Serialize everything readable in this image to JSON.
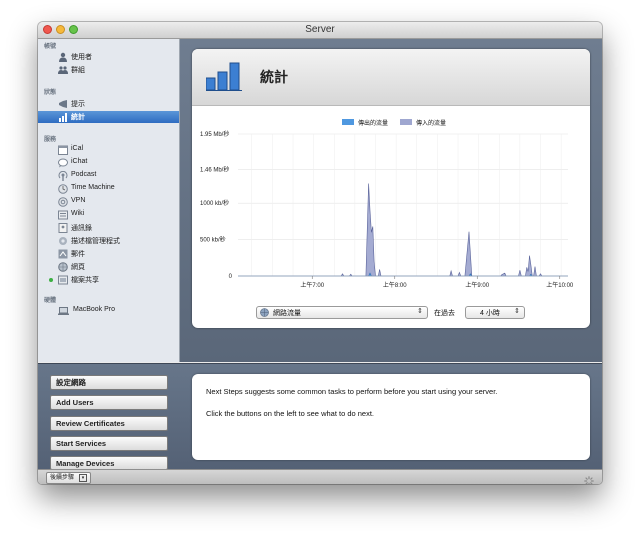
{
  "window": {
    "title": "Server"
  },
  "sidebar": {
    "sections": [
      {
        "header": "帳號",
        "items": [
          {
            "label": "使用者",
            "icon": "user-icon"
          },
          {
            "label": "群組",
            "icon": "group-icon"
          }
        ]
      },
      {
        "header": "狀態",
        "items": [
          {
            "label": "提示",
            "icon": "alert-icon"
          },
          {
            "label": "統計",
            "icon": "stats-icon",
            "selected": true
          }
        ]
      },
      {
        "header": "服務",
        "items": [
          {
            "label": "iCal",
            "icon": "calendar-icon"
          },
          {
            "label": "iChat",
            "icon": "chat-icon"
          },
          {
            "label": "Podcast",
            "icon": "podcast-icon"
          },
          {
            "label": "Time Machine",
            "icon": "time-machine-icon"
          },
          {
            "label": "VPN",
            "icon": "vpn-icon"
          },
          {
            "label": "Wiki",
            "icon": "wiki-icon"
          },
          {
            "label": "通訊錄",
            "icon": "contacts-icon"
          },
          {
            "label": "描述檔管理程式",
            "icon": "profile-manager-icon"
          },
          {
            "label": "郵件",
            "icon": "mail-icon"
          },
          {
            "label": "網頁",
            "icon": "web-icon"
          },
          {
            "label": "檔案共享",
            "icon": "file-sharing-icon",
            "status": "on"
          }
        ]
      },
      {
        "header": "硬體",
        "items": [
          {
            "label": "MacBook Pro",
            "icon": "laptop-icon"
          }
        ]
      }
    ]
  },
  "stats_panel": {
    "title": "統計",
    "icon": "bar-chart-icon",
    "metric_select": "網路流量",
    "range_label": "在過去",
    "range_select": "4 小時"
  },
  "chart_data": {
    "type": "area",
    "legend": [
      "傳出的流量",
      "傳入的流量"
    ],
    "legend_position": "top-center",
    "y_tick_labels": [
      "1.95 Mb/秒",
      "1.46 Mb/秒",
      "1000 kb/秒",
      "500 kb/秒",
      "0"
    ],
    "y_ticks_kbps": [
      1950,
      1460,
      1000,
      500,
      0
    ],
    "ylim": [
      0,
      1950
    ],
    "x_tick_labels": [
      "上午7:00",
      "上午8:00",
      "上午9:00",
      "上午10:00"
    ],
    "x_ticks": [
      "06:59",
      "07:59",
      "08:59",
      "09:59"
    ],
    "xlim": [
      "06:05",
      "10:05"
    ],
    "grid": true,
    "series": [
      {
        "name": "傳入的流量",
        "color": "#9fa7d0",
        "points": [
          [
            "06:05",
            0
          ],
          [
            "07:20",
            0
          ],
          [
            "07:21",
            30
          ],
          [
            "07:22",
            0
          ],
          [
            "07:26",
            0
          ],
          [
            "07:27",
            25
          ],
          [
            "07:28",
            0
          ],
          [
            "07:38",
            0
          ],
          [
            "07:40",
            1270
          ],
          [
            "07:41",
            900
          ],
          [
            "07:42",
            600
          ],
          [
            "07:43",
            680
          ],
          [
            "07:44",
            200
          ],
          [
            "07:45",
            0
          ],
          [
            "07:47",
            0
          ],
          [
            "07:48",
            90
          ],
          [
            "07:49",
            0
          ],
          [
            "08:39",
            0
          ],
          [
            "08:40",
            70
          ],
          [
            "08:41",
            0
          ],
          [
            "08:45",
            0
          ],
          [
            "08:46",
            50
          ],
          [
            "08:47",
            0
          ],
          [
            "08:50",
            0
          ],
          [
            "08:53",
            610
          ],
          [
            "08:55",
            0
          ],
          [
            "09:16",
            0
          ],
          [
            "09:17",
            20
          ],
          [
            "09:19",
            40
          ],
          [
            "09:20",
            0
          ],
          [
            "09:29",
            0
          ],
          [
            "09:30",
            80
          ],
          [
            "09:31",
            0
          ],
          [
            "09:34",
            0
          ],
          [
            "09:35",
            120
          ],
          [
            "09:36",
            60
          ],
          [
            "09:37",
            280
          ],
          [
            "09:38",
            150
          ],
          [
            "09:39",
            0
          ],
          [
            "09:40",
            0
          ],
          [
            "09:41",
            130
          ],
          [
            "09:42",
            0
          ],
          [
            "09:44",
            0
          ],
          [
            "09:45",
            30
          ],
          [
            "09:46",
            0
          ],
          [
            "10:05",
            0
          ]
        ]
      },
      {
        "name": "傳出的流量",
        "color": "#4f98e0",
        "points": [
          [
            "06:05",
            0
          ],
          [
            "07:40",
            0
          ],
          [
            "07:41",
            40
          ],
          [
            "07:42",
            0
          ],
          [
            "08:53",
            0
          ],
          [
            "08:54",
            30
          ],
          [
            "08:55",
            0
          ],
          [
            "09:37",
            0
          ],
          [
            "09:38",
            25
          ],
          [
            "09:39",
            0
          ],
          [
            "10:05",
            0
          ]
        ]
      }
    ]
  },
  "next_steps": {
    "buttons": [
      "設定網路",
      "Add Users",
      "Review Certificates",
      "Start Services",
      "Manage Devices"
    ],
    "description": [
      "Next Steps suggests some common tasks to perform before you start using your server.",
      "Click the buttons on the left to see what to do next."
    ]
  },
  "statusbar": {
    "next_steps_toggle": "後續步驟"
  }
}
